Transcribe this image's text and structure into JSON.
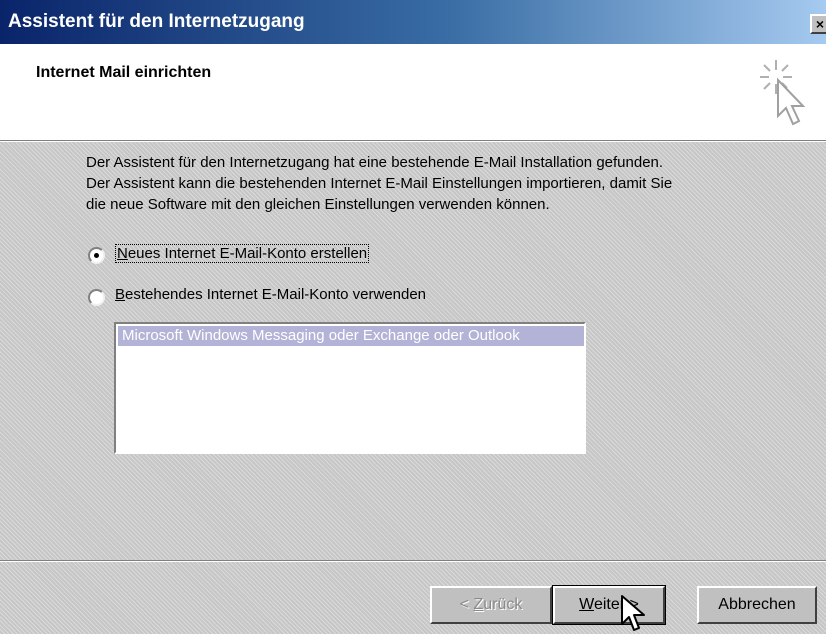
{
  "window": {
    "title": "Assistent für den Internetzugang",
    "close_label": "×"
  },
  "header": {
    "title": "Internet Mail einrichten",
    "icon": "wizard-cursor-sparkle-icon"
  },
  "description": {
    "lines": [
      "Der Assistent für den Internetzugang hat eine bestehende E-Mail Installation gefunden.",
      "Der Assistent kann die bestehenden Internet E-Mail Einstellungen importieren, damit Sie",
      "die neue Software mit den gleichen Einstellungen verwenden können."
    ]
  },
  "options": {
    "new_account": {
      "mnemonic": "N",
      "label_rest": "eues Internet E-Mail-Konto erstellen",
      "selected": true
    },
    "existing_account": {
      "mnemonic": "B",
      "label_rest": "estehendes Internet E-Mail-Konto verwenden",
      "selected": false
    }
  },
  "existing_list": {
    "items": [
      "Microsoft Windows Messaging oder Exchange oder Outlook"
    ],
    "selected_index": 0
  },
  "buttons": {
    "back": {
      "prefix": "< ",
      "mnemonic": "Z",
      "rest": "urück",
      "enabled": false
    },
    "next": {
      "mnemonic": "W",
      "rest": "eiter >",
      "enabled": true
    },
    "cancel": {
      "label": "Abbrechen",
      "enabled": true
    }
  },
  "colors": {
    "titlebar_start": "#0a246a",
    "titlebar_end": "#a6caf0",
    "list_selection": "#b3b3d7"
  }
}
